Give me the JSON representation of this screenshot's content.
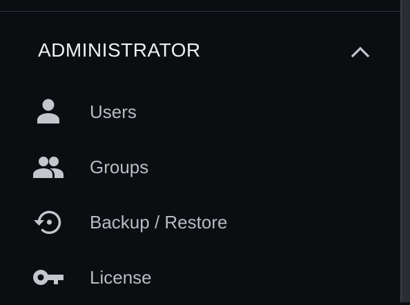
{
  "section": {
    "title": "ADMINISTRATOR",
    "expanded": true,
    "toggle_icon": "chevron-up-icon"
  },
  "menu": {
    "items": [
      {
        "label": "Users",
        "icon": "person-icon"
      },
      {
        "label": "Groups",
        "icon": "people-icon"
      },
      {
        "label": "Backup / Restore",
        "icon": "restore-icon"
      },
      {
        "label": "License",
        "icon": "key-icon"
      }
    ]
  },
  "colors": {
    "background": "#0b0d11",
    "title_text": "#eef0f3",
    "item_text": "#b8bcc3",
    "icon": "#c3c6cc",
    "divider": "#2b3140",
    "scrollbar": "#2a2d33"
  }
}
